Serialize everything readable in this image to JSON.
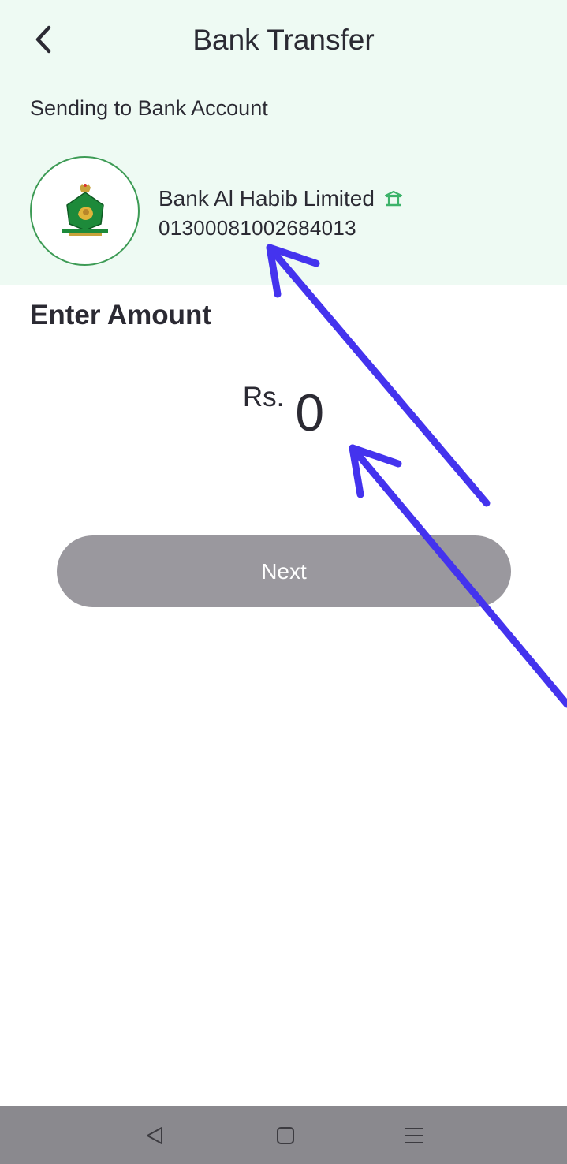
{
  "header": {
    "title": "Bank Transfer",
    "back_icon": "chevron-left-icon"
  },
  "recipient": {
    "section_label": "Sending to Bank Account",
    "bank_name": "Bank Al Habib Limited",
    "account_number": "01300081002684013",
    "bank_icon": "bank-building-icon"
  },
  "amount": {
    "title": "Enter Amount",
    "currency": "Rs.",
    "value": "0"
  },
  "actions": {
    "next_label": "Next"
  },
  "system_nav": {
    "back_icon": "triangle-back-icon",
    "home_icon": "square-home-icon",
    "menu_icon": "three-lines-menu-icon"
  },
  "colors": {
    "header_bg": "#eefaf3",
    "accent_green": "#3d9b55",
    "button_disabled": "#9a989e",
    "annotation_arrow": "#4433ee",
    "nav_bar": "#8a898e"
  }
}
